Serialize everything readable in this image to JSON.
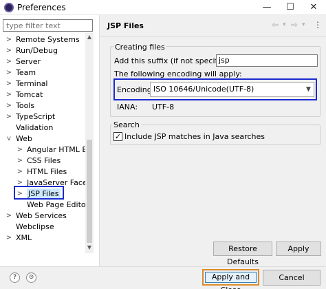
{
  "window": {
    "title": "Preferences",
    "minimize": "—",
    "maximize": "☐",
    "close": "✕"
  },
  "filter": {
    "placeholder": "type filter text"
  },
  "tree": {
    "items": [
      {
        "label": "Remote Systems",
        "chevron": ">"
      },
      {
        "label": "Run/Debug",
        "chevron": ">"
      },
      {
        "label": "Server",
        "chevron": ">"
      },
      {
        "label": "Team",
        "chevron": ">"
      },
      {
        "label": "Terminal",
        "chevron": ">"
      },
      {
        "label": "Tomcat",
        "chevron": ">"
      },
      {
        "label": "Tools",
        "chevron": ">"
      },
      {
        "label": "TypeScript",
        "chevron": ">"
      },
      {
        "label": "Validation",
        "chevron": ""
      },
      {
        "label": "Web",
        "chevron": "v"
      },
      {
        "label": "Angular HTML Edi",
        "chevron": ">"
      },
      {
        "label": "CSS Files",
        "chevron": ">"
      },
      {
        "label": "HTML Files",
        "chevron": ">"
      },
      {
        "label": "JavaServer Faces T",
        "chevron": ">"
      },
      {
        "label": "JSP Files",
        "chevron": ">"
      },
      {
        "label": "Web Page Editor",
        "chevron": ""
      },
      {
        "label": "Web Services",
        "chevron": ">"
      },
      {
        "label": "Webclipse",
        "chevron": ""
      },
      {
        "label": "XML",
        "chevron": ">"
      }
    ]
  },
  "panel": {
    "title": "JSP Files",
    "nav": {
      "back": "⇦",
      "back_menu": "▾",
      "forward": "⇨",
      "forward_menu": "▾",
      "menu": "⋮"
    },
    "creating_files": {
      "legend": "Creating files",
      "suffix_label": "Add this suffix (if not specified):",
      "suffix_value": "jsp",
      "encoding_note": "The following encoding will apply:",
      "encoding_label": "Encoding:",
      "encoding_value": "ISO 10646/Unicode(UTF-8)",
      "iana_label": "IANA:",
      "iana_value": "UTF-8"
    },
    "search": {
      "legend": "Search",
      "include_label": "Include JSP matches in Java searches",
      "include_checked": true,
      "check_glyph": "✓"
    },
    "restore_defaults": "Restore Defaults",
    "apply": "Apply"
  },
  "bottom": {
    "help_glyph": "?",
    "import_glyph": "⊙",
    "apply_and_close": "Apply and Close",
    "cancel": "Cancel"
  },
  "colors": {
    "highlight_border": "#1a2bd0",
    "default_button_border": "#e08a2b"
  }
}
